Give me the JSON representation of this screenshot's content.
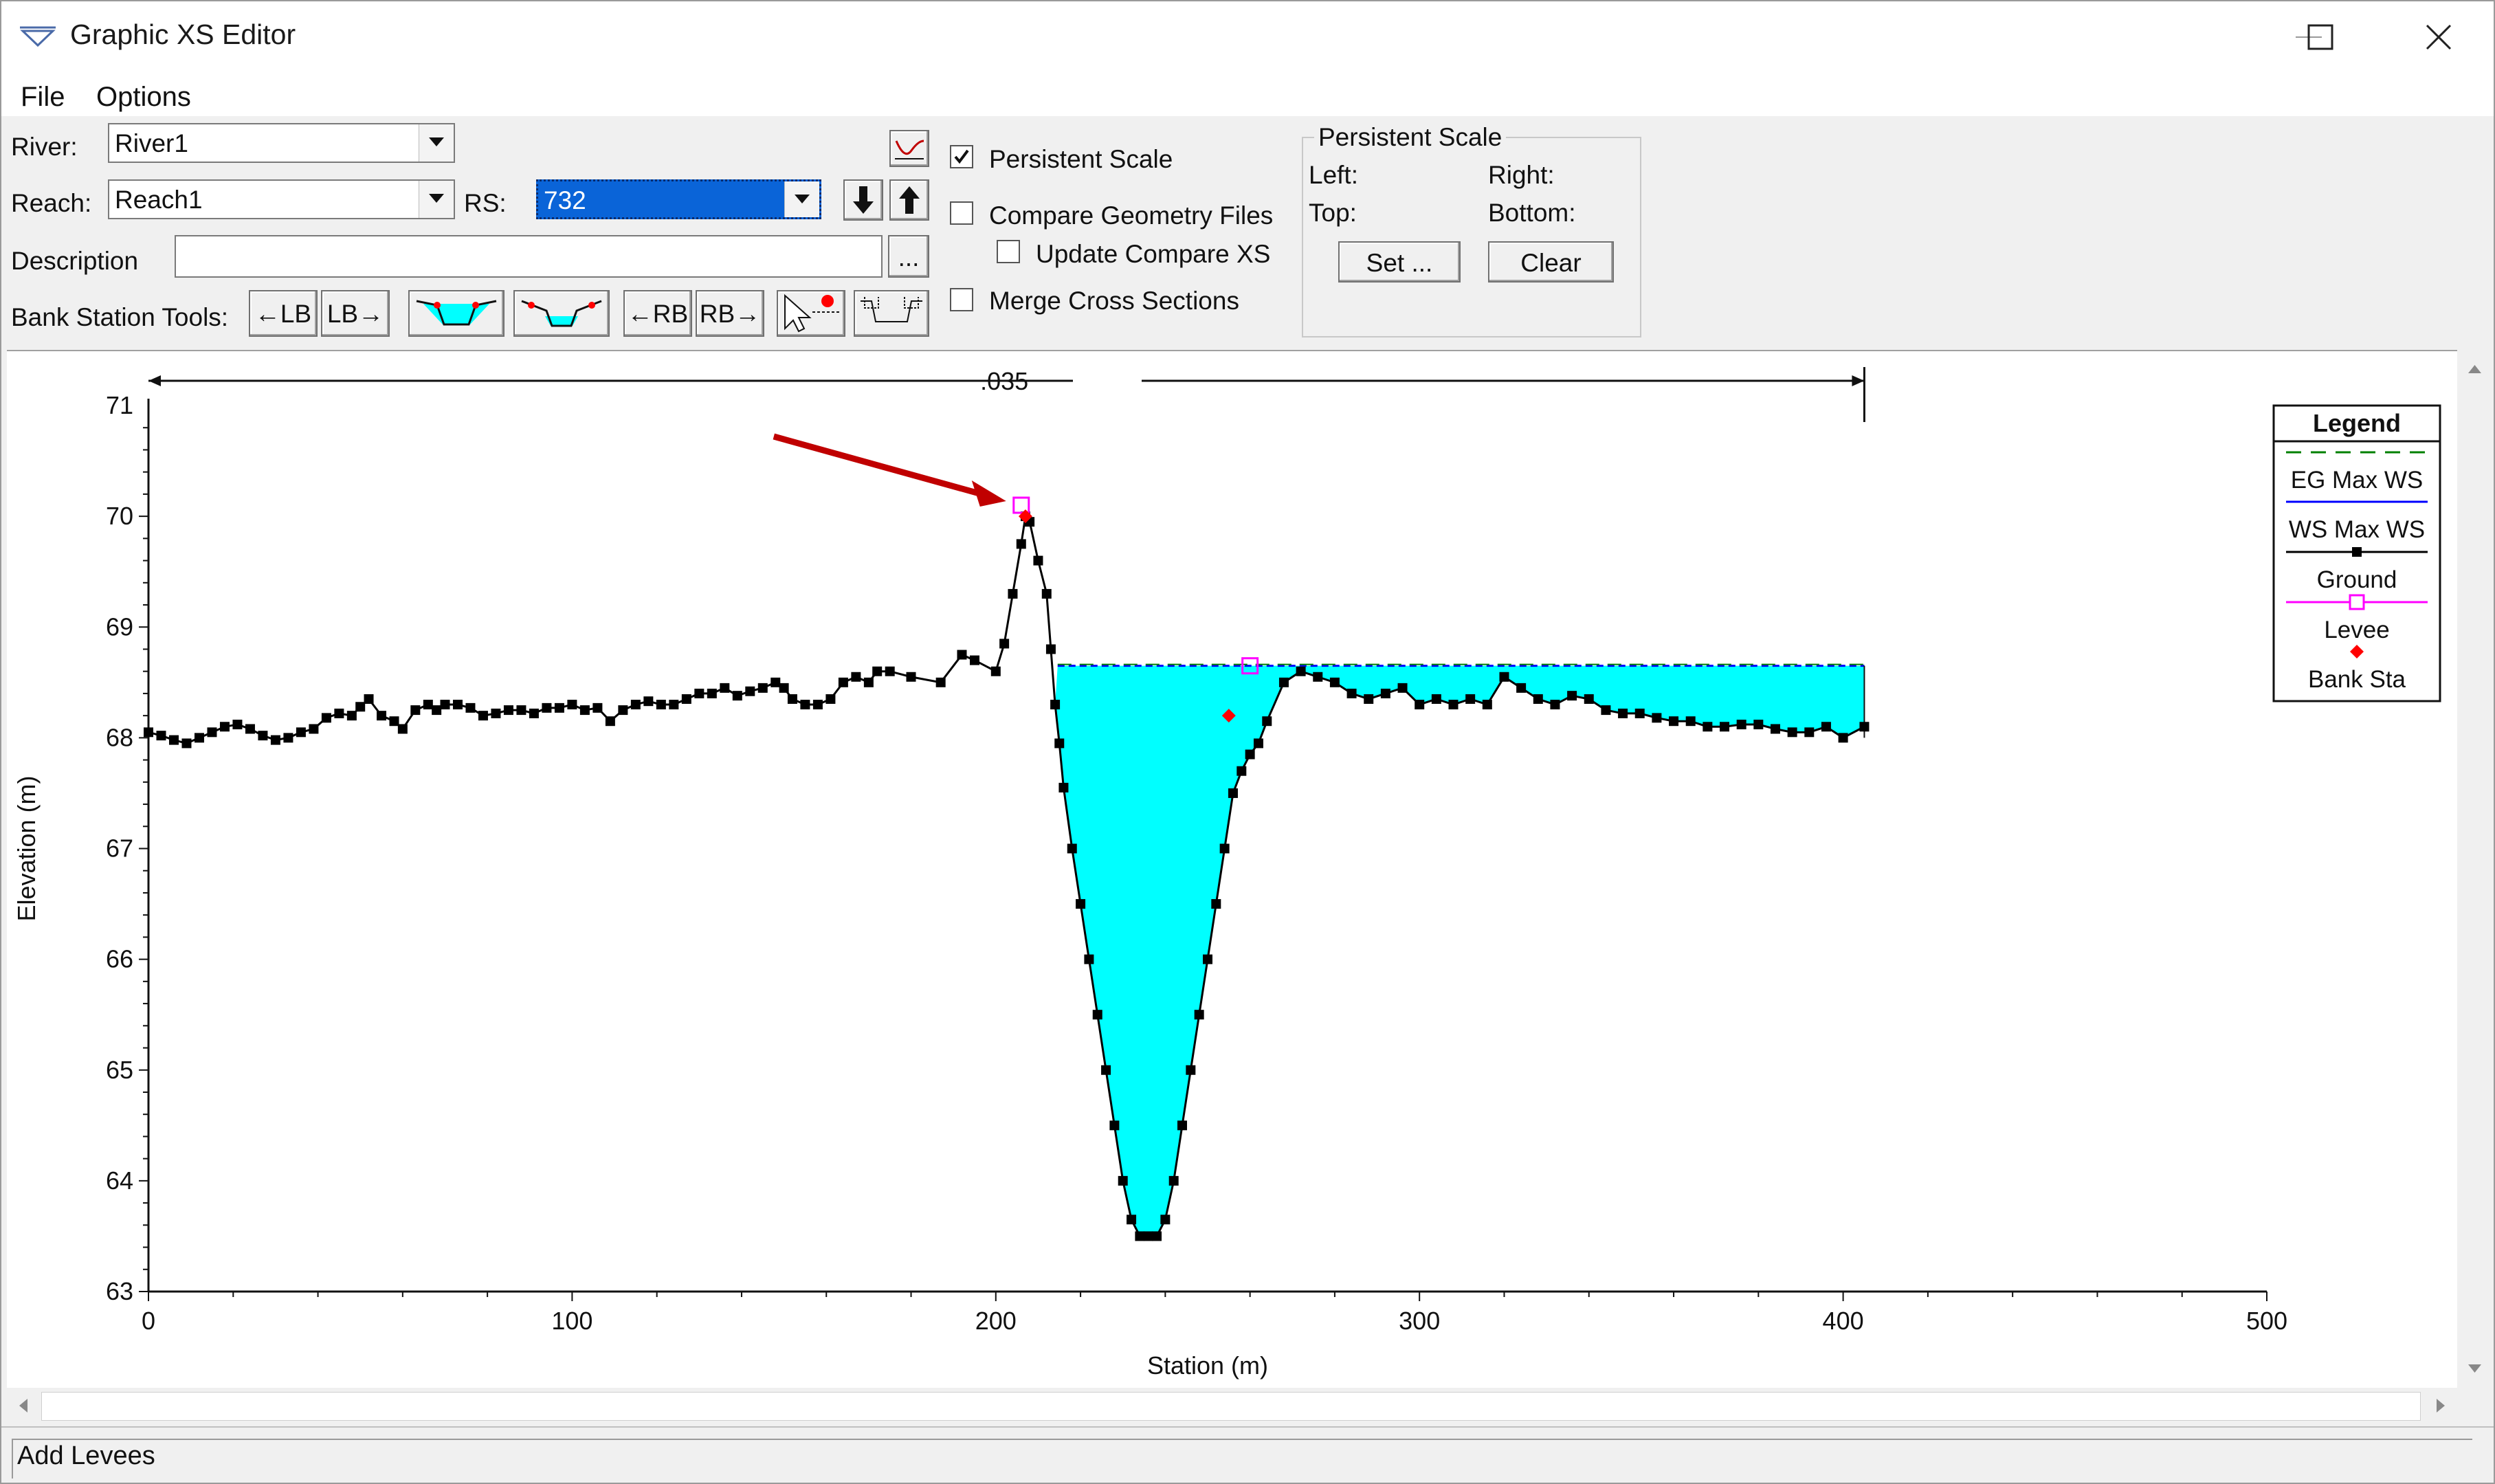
{
  "window": {
    "title": "Graphic XS Editor"
  },
  "menu": {
    "file": "File",
    "options": "Options"
  },
  "controls": {
    "river_label": "River:",
    "river_value": "River1",
    "reach_label": "Reach:",
    "reach_value": "Reach1",
    "rs_label": "RS:",
    "rs_value": "732",
    "description_label": "Description",
    "description_value": "",
    "ellipsis": "...",
    "bank_tools_label": "Bank Station Tools:",
    "tool_left_lb": "←LB",
    "tool_lb_right": "LB→",
    "tool_left_rb": "←RB",
    "tool_rb_right": "RB→"
  },
  "options": {
    "persistent_scale": {
      "label": "Persistent Scale",
      "checked": true
    },
    "compare_geometry": {
      "label": "Compare Geometry Files",
      "checked": false
    },
    "update_compare": {
      "label": "Update Compare XS",
      "checked": false
    },
    "merge_sections": {
      "label": "Merge Cross Sections",
      "checked": false
    }
  },
  "scale_group": {
    "title": "Persistent Scale",
    "left": "Left:",
    "right": "Right:",
    "top": "Top:",
    "bottom": "Bottom:",
    "set_button": "Set ...",
    "clear_button": "Clear"
  },
  "status": {
    "text": "Add Levees"
  },
  "colors": {
    "water": "#00ffff",
    "ground": "#000000",
    "levee": "#ff00ff",
    "bank": "#ff0000",
    "ws": "#0000ff",
    "eg": "#008000",
    "arrow": "#c00000"
  },
  "chart_data": {
    "type": "line",
    "xlabel": "Station (m)",
    "ylabel": "Elevation (m)",
    "xlim": [
      0,
      500
    ],
    "ylim": [
      63,
      71
    ],
    "x_ticks": [
      "0",
      "100",
      "200",
      "300",
      "400",
      "500"
    ],
    "y_ticks": [
      "63",
      "64",
      "65",
      "66",
      "67",
      "68",
      "69",
      "70",
      "71"
    ],
    "manning_label": ".035",
    "manning_extent": [
      0,
      405
    ],
    "legend": {
      "title": "Legend",
      "items": [
        "EG Max WS",
        "WS Max WS",
        "Ground",
        "Levee",
        "Bank Sta"
      ]
    },
    "water_surface_elevation": 68.65,
    "ground": {
      "x": [
        0,
        3,
        6,
        9,
        12,
        15,
        18,
        21,
        24,
        27,
        30,
        33,
        36,
        39,
        42,
        45,
        48,
        50,
        52,
        55,
        58,
        60,
        63,
        66,
        68,
        70,
        73,
        76,
        79,
        82,
        85,
        88,
        91,
        94,
        97,
        100,
        103,
        106,
        109,
        112,
        115,
        118,
        121,
        124,
        127,
        130,
        133,
        136,
        139,
        142,
        145,
        148,
        150,
        152,
        155,
        158,
        161,
        164,
        167,
        170,
        172,
        175,
        180,
        187,
        192,
        195,
        200,
        202,
        204,
        206,
        207,
        208,
        210,
        212,
        213,
        214,
        215,
        216,
        218,
        220,
        222,
        224,
        226,
        228,
        230,
        232,
        234,
        236,
        238,
        240,
        242,
        244,
        246,
        248,
        250,
        252,
        254,
        256,
        258,
        260,
        262,
        264,
        268,
        272,
        276,
        280,
        284,
        288,
        292,
        296,
        300,
        304,
        308,
        312,
        316,
        320,
        324,
        328,
        332,
        336,
        340,
        344,
        348,
        352,
        356,
        360,
        364,
        368,
        372,
        376,
        380,
        384,
        388,
        392,
        396,
        400,
        405
      ],
      "y": [
        68.05,
        68.02,
        67.98,
        67.95,
        68.0,
        68.05,
        68.1,
        68.12,
        68.08,
        68.02,
        67.98,
        68.0,
        68.05,
        68.08,
        68.18,
        68.22,
        68.2,
        68.28,
        68.35,
        68.2,
        68.15,
        68.08,
        68.25,
        68.3,
        68.25,
        68.3,
        68.3,
        68.27,
        68.2,
        68.22,
        68.25,
        68.25,
        68.22,
        68.27,
        68.27,
        68.3,
        68.25,
        68.27,
        68.15,
        68.25,
        68.3,
        68.33,
        68.3,
        68.3,
        68.35,
        68.4,
        68.4,
        68.45,
        68.38,
        68.42,
        68.45,
        68.5,
        68.45,
        68.35,
        68.3,
        68.3,
        68.35,
        68.5,
        68.55,
        68.5,
        68.6,
        68.6,
        68.55,
        68.5,
        68.75,
        68.7,
        68.6,
        68.85,
        69.3,
        69.75,
        70.0,
        69.95,
        69.6,
        69.3,
        68.8,
        68.3,
        67.95,
        67.55,
        67.0,
        66.5,
        66.0,
        65.5,
        65.0,
        64.5,
        64.0,
        63.65,
        63.5,
        63.5,
        63.5,
        63.65,
        64.0,
        64.5,
        65.0,
        65.5,
        66.0,
        66.5,
        67.0,
        67.5,
        67.7,
        67.85,
        67.95,
        68.15,
        68.5,
        68.6,
        68.55,
        68.5,
        68.4,
        68.35,
        68.4,
        68.45,
        68.3,
        68.35,
        68.3,
        68.35,
        68.3,
        68.55,
        68.45,
        68.35,
        68.3,
        68.38,
        68.35,
        68.25,
        68.22,
        68.22,
        68.18,
        68.15,
        68.15,
        68.1,
        68.1,
        68.12,
        68.12,
        68.08,
        68.05,
        68.05,
        68.1,
        68.0,
        68.1,
        68.05,
        68.0,
        68.15,
        67.95,
        68.0
      ]
    },
    "levees": [
      {
        "x": 206,
        "y": 70.1
      },
      {
        "x": 260,
        "y": 68.65
      }
    ],
    "bank_stations": [
      {
        "x": 207,
        "y": 70.0
      },
      {
        "x": 255,
        "y": 68.2
      }
    ]
  }
}
